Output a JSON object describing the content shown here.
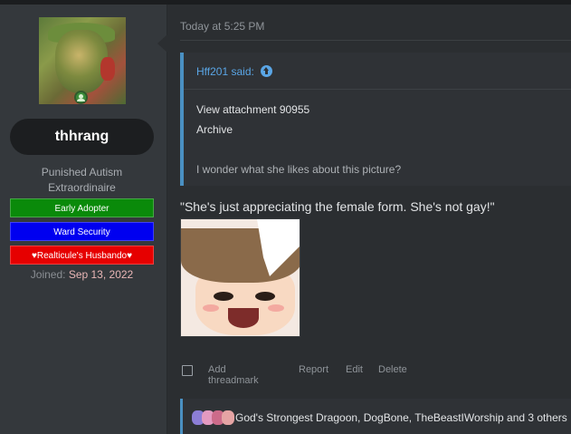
{
  "user": {
    "username": "thhrang",
    "title_line1": "Punished Autism",
    "title_line2": "Extraordinaire",
    "banners": [
      {
        "label": "Early Adopter",
        "color": "#0a8a0a"
      },
      {
        "label": "Ward Security",
        "color": "#0000f0"
      },
      {
        "label": "♥Realticule's Husbando♥",
        "color": "#e60000"
      }
    ],
    "joined_label": "Joined:",
    "joined_date": "Sep 13, 2022",
    "avatar_icon": "avatar-image",
    "status_icon": "online-user-icon"
  },
  "post": {
    "timestamp": "Today at 5:25 PM",
    "quote": {
      "author_line": "Hff201 said:",
      "jump_icon": "arrow-up-circle-icon",
      "lines": [
        "View attachment 90955",
        "Archive",
        "I wonder what she likes about this picture?"
      ]
    },
    "body_text": "\"She's just appreciating the female form. She's not gay!\"",
    "attachment_icon": "anime-girl-image",
    "actions": {
      "add_threadmark": "Add threadmark",
      "report": "Report",
      "edit": "Edit",
      "delete": "Delete"
    },
    "reactions_text": "God's Strongest Dragoon, DogBone, TheBeastIWorship and 3 others"
  },
  "colors": {
    "accent_blue": "#4a90c2",
    "link_blue": "#5aa6e6",
    "panel_bg": "#2b2e31",
    "user_panel_bg": "#34383c"
  }
}
